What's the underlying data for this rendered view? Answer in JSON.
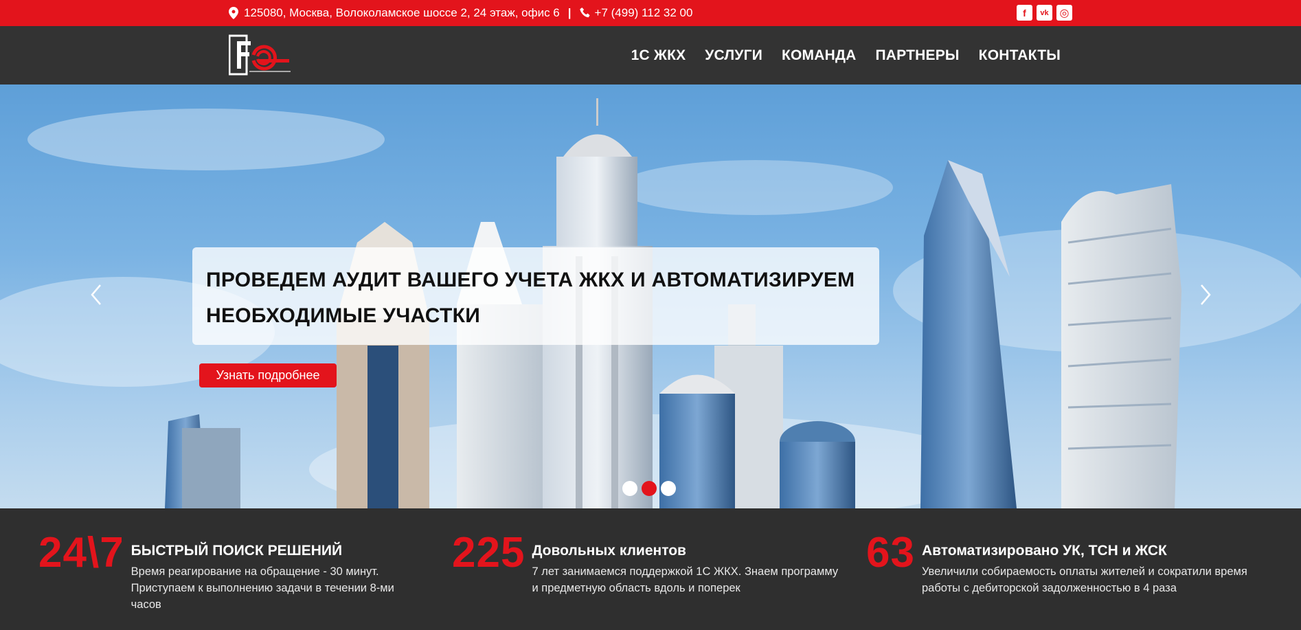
{
  "topbar": {
    "address": "125080, Москва, Волоколамское шоссе 2, 24 этаж, офис 6",
    "separator": "|",
    "phone": "+7 (499) 112 32 00",
    "socials": [
      {
        "icon": "facebook-icon",
        "glyph": "f"
      },
      {
        "icon": "vk-icon",
        "glyph": "vk"
      },
      {
        "icon": "instagram-icon",
        "glyph": "◎"
      }
    ]
  },
  "nav": {
    "items": [
      "1С ЖКХ",
      "УСЛУГИ",
      "КОМАНДА",
      "ПАРТНЕРЫ",
      "КОНТАКТЫ"
    ]
  },
  "hero": {
    "headline": "ПРОВЕДЕМ АУДИТ ВАШЕГО УЧЕТА ЖКХ И АВТОМАТИЗИРУЕМ НЕОБХОДИМЫЕ УЧАСТКИ",
    "cta_label": "Узнать подробнее",
    "slides_count": 3,
    "active_slide": 2
  },
  "stats": [
    {
      "number": "24\\7",
      "title": "БЫСТРЫЙ ПОИСК РЕШЕНИЙ",
      "desc_lines": [
        "Время реагирование на обращение - 30 минут.",
        "Приступаем к выполнению задачи в течении 8-ми",
        "часов"
      ]
    },
    {
      "number": "225",
      "title": "Довольных клиентов",
      "desc_lines": [
        "7 лет занимаемся поддержкой 1С ЖКХ. Знаем программу",
        "и предметную область вдоль и поперек"
      ]
    },
    {
      "number": "63",
      "title": "Автоматизировано УК, ТСН и ЖСК",
      "desc_lines": [
        "Увеличили собираемость оплаты жителей и сократили время",
        "работы с дебиторской задолженностью в 4 раза"
      ]
    }
  ],
  "colors": {
    "accent": "#e3141c",
    "header_bg": "#333333",
    "stats_bg": "#2f2f2f"
  }
}
